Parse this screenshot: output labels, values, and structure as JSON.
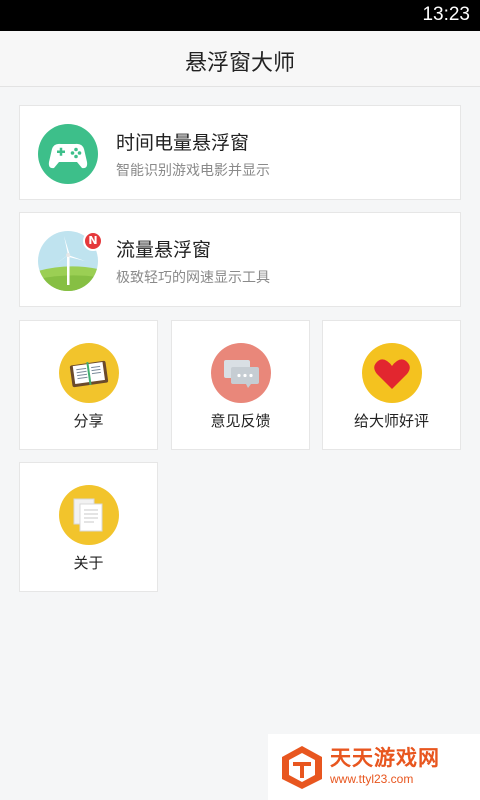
{
  "status_bar": {
    "time": "13:23"
  },
  "header": {
    "title": "悬浮窗大师"
  },
  "features": [
    {
      "title": "时间电量悬浮窗",
      "subtitle": "智能识别游戏电影并显示",
      "icon": "gamepad-icon"
    },
    {
      "title": "流量悬浮窗",
      "subtitle": "极致轻巧的网速显示工具",
      "icon": "windmill-icon",
      "badge": "N"
    }
  ],
  "tiles": [
    {
      "label": "分享",
      "icon": "notebook-icon"
    },
    {
      "label": "意见反馈",
      "icon": "chat-bubble-icon"
    },
    {
      "label": "给大师好评",
      "icon": "heart-icon"
    },
    {
      "label": "关于",
      "icon": "documents-icon"
    }
  ],
  "watermark": {
    "text": "天天游戏网",
    "url": "www.ttyl23.com"
  },
  "colors": {
    "gamepad_bg": "#3dbf8a",
    "share_bg": "#f2c42c",
    "feedback_bg": "#e9877a",
    "rate_bg": "#f4c21f",
    "heart": "#e2262f",
    "about_bg": "#f2c42c",
    "badge": "#e5383b",
    "watermark": "#e8561f"
  }
}
